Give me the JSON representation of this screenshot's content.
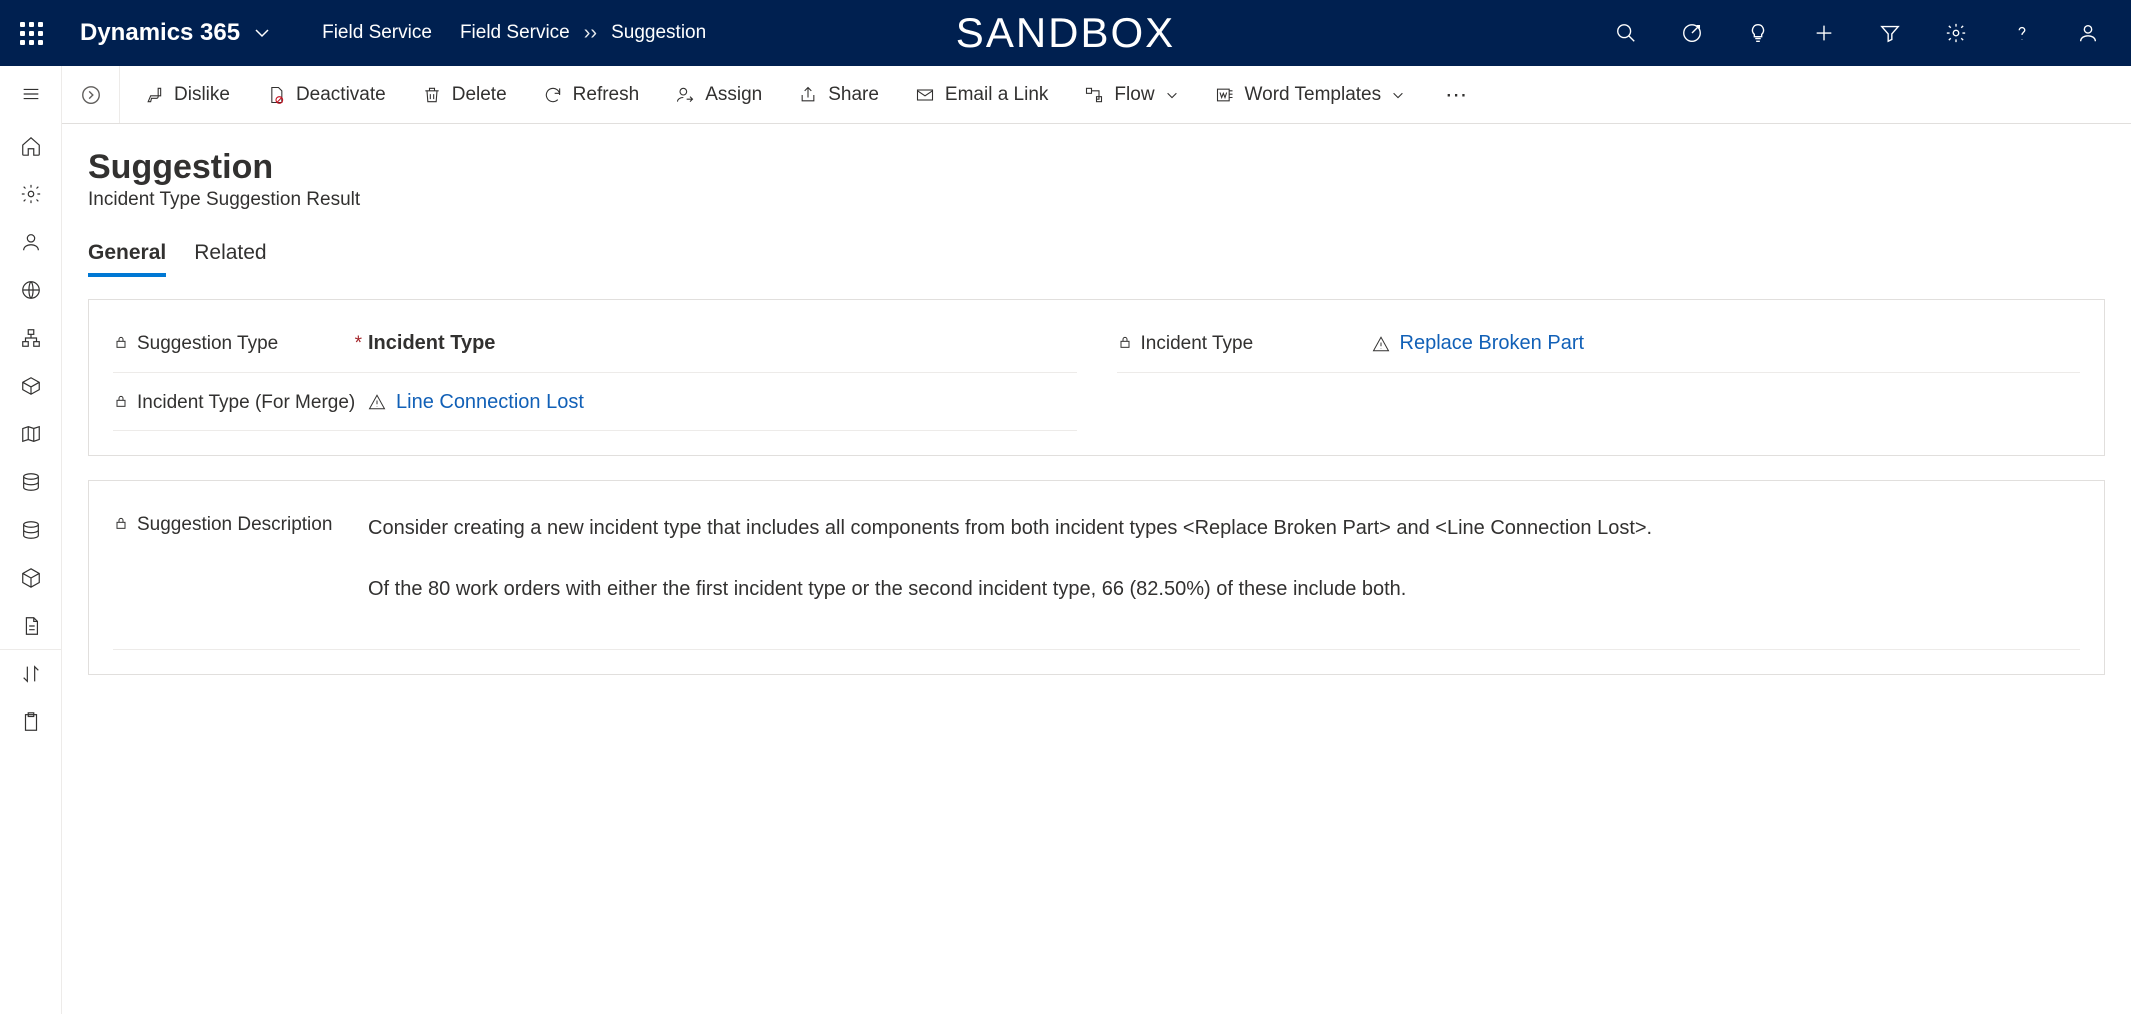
{
  "header": {
    "brand": "Dynamics 365",
    "breadcrumb": [
      "Field Service",
      "Field Service",
      "Suggestion"
    ],
    "sandbox_label": "SANDBOX"
  },
  "commandbar": {
    "dislike": "Dislike",
    "deactivate": "Deactivate",
    "delete": "Delete",
    "refresh": "Refresh",
    "assign": "Assign",
    "share": "Share",
    "email_link": "Email a Link",
    "flow": "Flow",
    "word_templates": "Word Templates"
  },
  "page": {
    "title": "Suggestion",
    "subtitle": "Incident Type Suggestion Result",
    "tabs": {
      "general": "General",
      "related": "Related"
    }
  },
  "fields": {
    "suggestion_type": {
      "label": "Suggestion Type",
      "value": "Incident Type"
    },
    "incident_type": {
      "label": "Incident Type",
      "value": "Replace Broken Part"
    },
    "incident_type_for_merge": {
      "label": "Incident Type (For Merge)",
      "value": "Line Connection Lost"
    },
    "suggestion_description": {
      "label": "Suggestion Description",
      "para1": "Consider creating a new incident type that includes all components from both incident types <Replace Broken Part> and <Line Connection Lost>.",
      "para2": "Of the 80 work orders with either the first incident type or the second incident type, 66 (82.50%) of these include both."
    }
  }
}
